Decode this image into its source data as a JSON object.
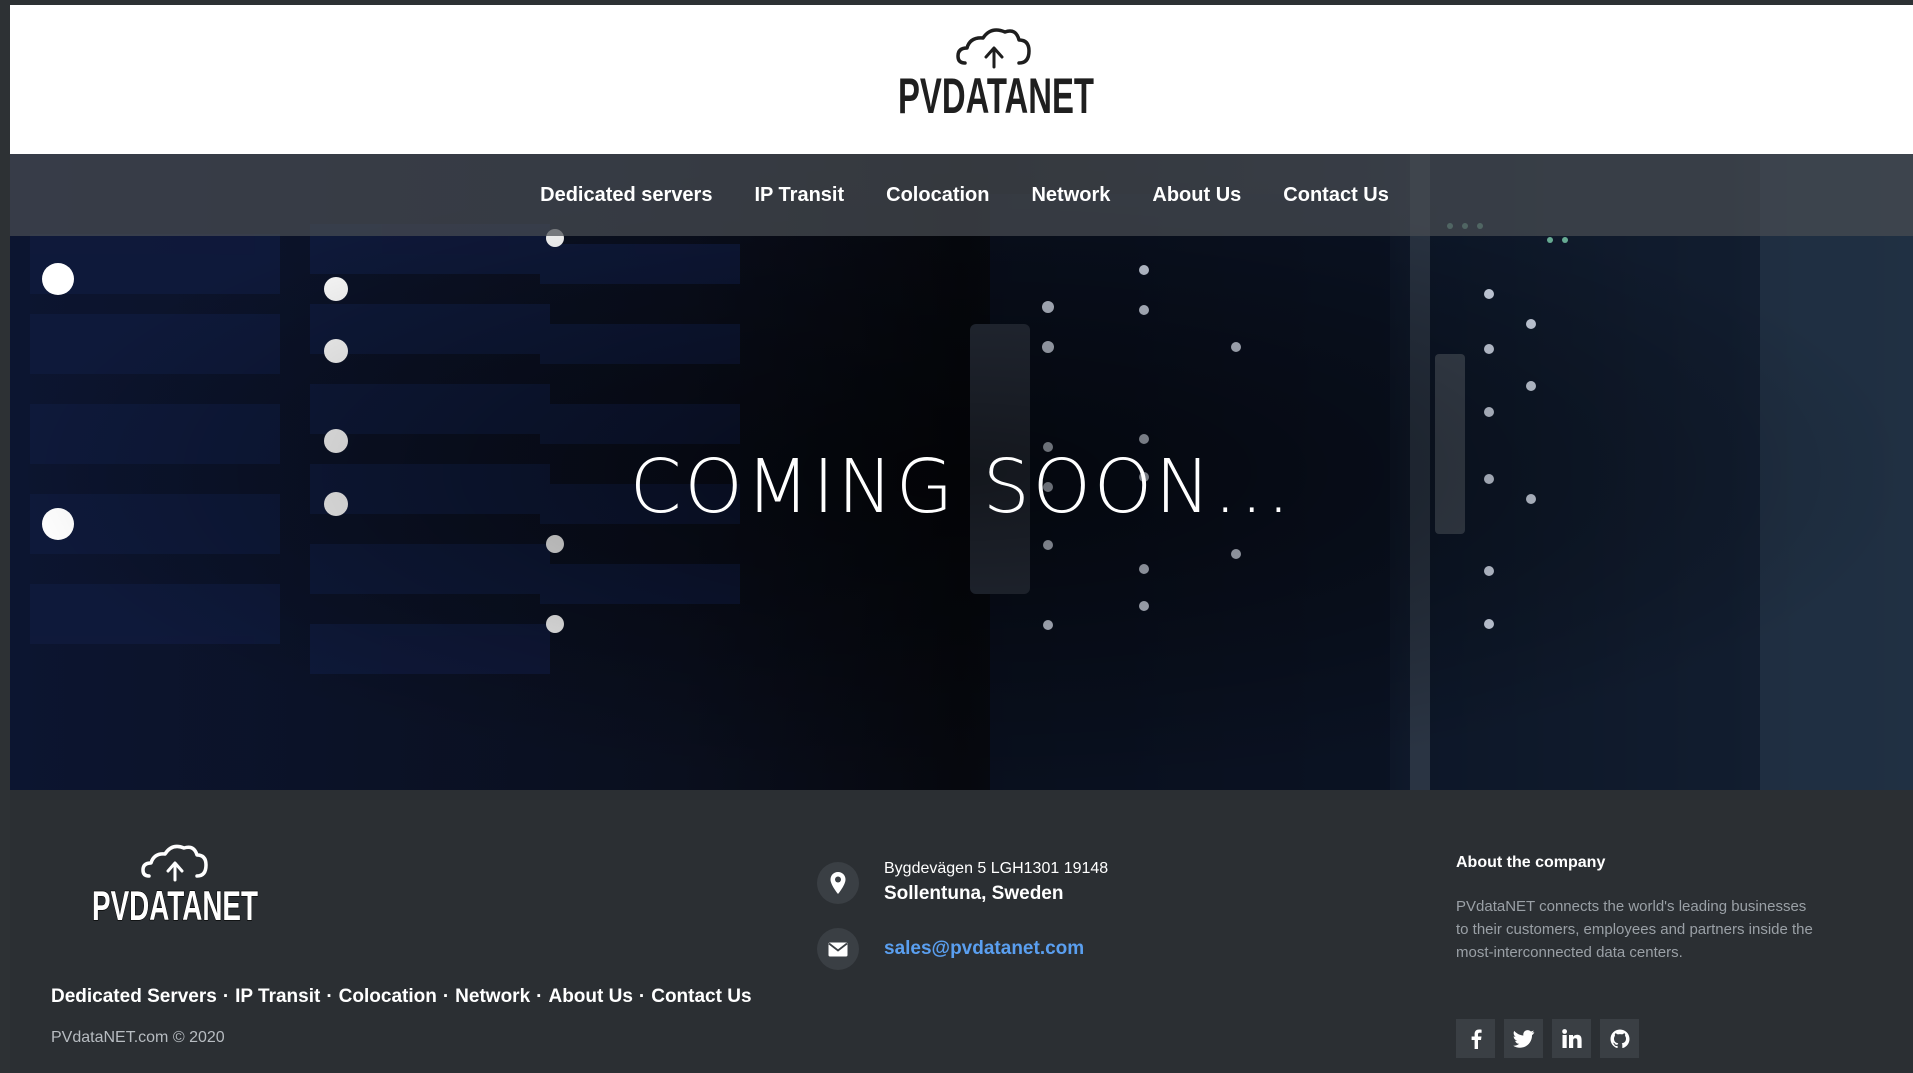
{
  "brand": {
    "name": "PVDATANET"
  },
  "nav": {
    "items": [
      {
        "label": "Dedicated servers"
      },
      {
        "label": "IP Transit"
      },
      {
        "label": "Colocation"
      },
      {
        "label": "Network"
      },
      {
        "label": "About Us"
      },
      {
        "label": "Contact Us"
      }
    ]
  },
  "hero": {
    "headline": "COMING SOON..."
  },
  "footer": {
    "links": [
      {
        "label": "Dedicated Servers"
      },
      {
        "label": "IP Transit"
      },
      {
        "label": "Colocation"
      },
      {
        "label": "Network"
      },
      {
        "label": "About Us"
      },
      {
        "label": "Contact Us"
      }
    ],
    "separator": "·",
    "copyright": "PVdataNET.com © 2020",
    "address": {
      "line1": "Bygdevägen 5 LGH1301 19148",
      "line2": "Sollentuna, Sweden",
      "icon": "map-pin-icon"
    },
    "email": {
      "value": "sales@pvdatanet.com",
      "icon": "envelope-icon"
    },
    "about": {
      "title": "About the company",
      "text": "PVdataNET connects the world's leading businesses to their customers, employees and partners inside the most-interconnected data centers."
    },
    "socials": [
      {
        "icon": "facebook-icon"
      },
      {
        "icon": "twitter-icon"
      },
      {
        "icon": "linkedin-icon"
      },
      {
        "icon": "github-icon"
      }
    ]
  },
  "colors": {
    "header_bg": "#ffffff",
    "nav_bg": "#484c52",
    "footer_bg": "#2b2f33",
    "link_accent": "#5a9ff0",
    "muted_text": "#9aa0a6"
  }
}
